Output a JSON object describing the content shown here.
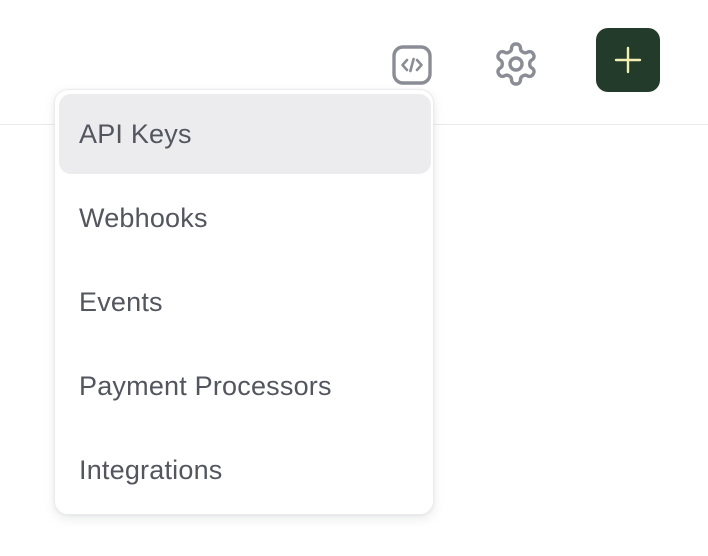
{
  "toolbar": {
    "developer_icon": "code-icon",
    "settings_icon": "gear-icon",
    "add_icon": "plus-icon"
  },
  "menu": {
    "items": [
      {
        "label": "API Keys",
        "active": true
      },
      {
        "label": "Webhooks",
        "active": false
      },
      {
        "label": "Events",
        "active": false
      },
      {
        "label": "Payment Processors",
        "active": false
      },
      {
        "label": "Integrations",
        "active": false
      }
    ]
  },
  "colors": {
    "primary_button": "#233b2a",
    "primary_button_icon": "#f3efb0",
    "icon_gray": "#8b8d96",
    "menu_text": "#53555f",
    "active_item_bg": "#ececee"
  }
}
